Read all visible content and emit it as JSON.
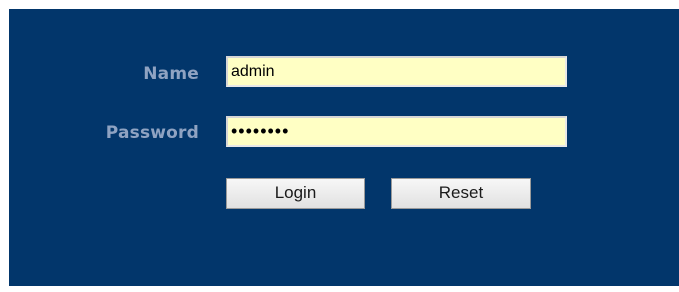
{
  "form": {
    "name_label": "Name",
    "name_value": "admin",
    "password_label": "Password",
    "password_value": "••••••••",
    "login_label": "Login",
    "reset_label": "Reset"
  },
  "colors": {
    "panel_background": "#02366b",
    "label_text": "#8fa3c2",
    "input_background": "#ffffc4"
  }
}
